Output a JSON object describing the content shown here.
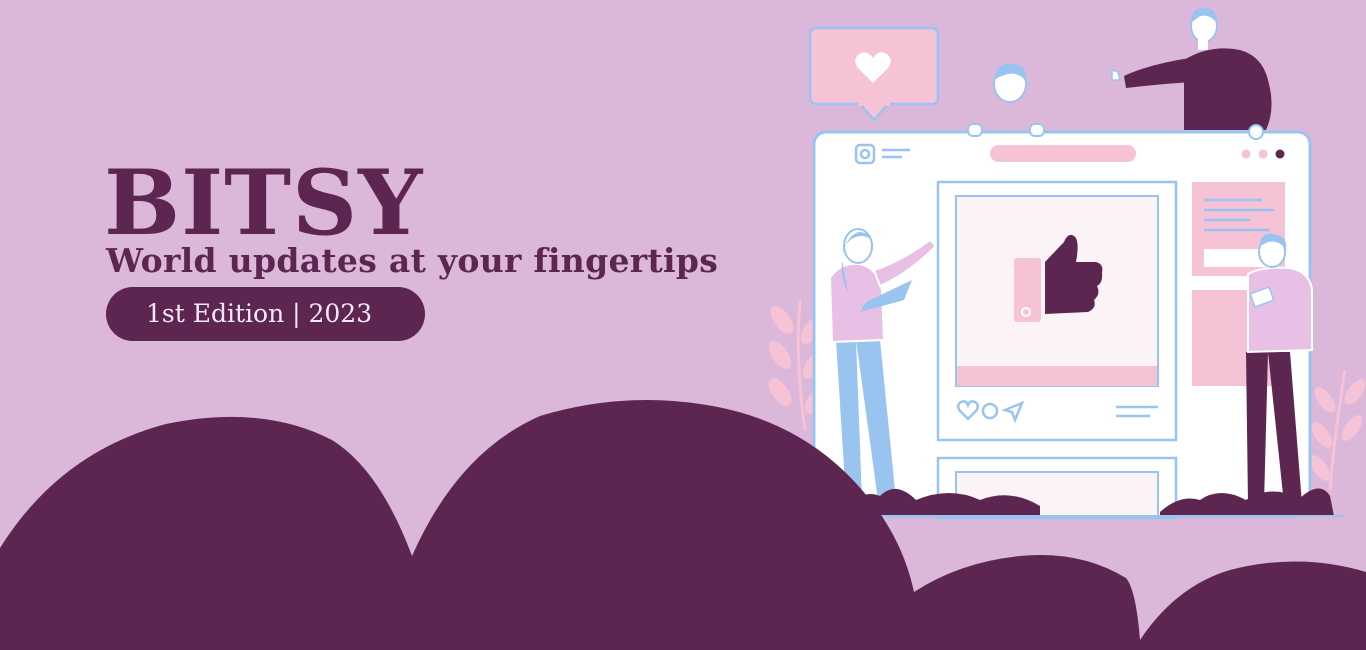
{
  "brand": {
    "title": "BITSY",
    "tagline": "World updates at your fingertips",
    "edition": "1st Edition | 2023"
  },
  "colors": {
    "background": "#dbb7da",
    "plum": "#5c2650",
    "pink": "#f6c2d6",
    "light_blue": "#9ac4f0",
    "white": "#ffffff"
  },
  "illustration": {
    "icons": [
      "heart-icon",
      "thumbs-up-icon",
      "instagram-icon",
      "comment-icon",
      "send-icon",
      "menu-dots-icon"
    ]
  }
}
